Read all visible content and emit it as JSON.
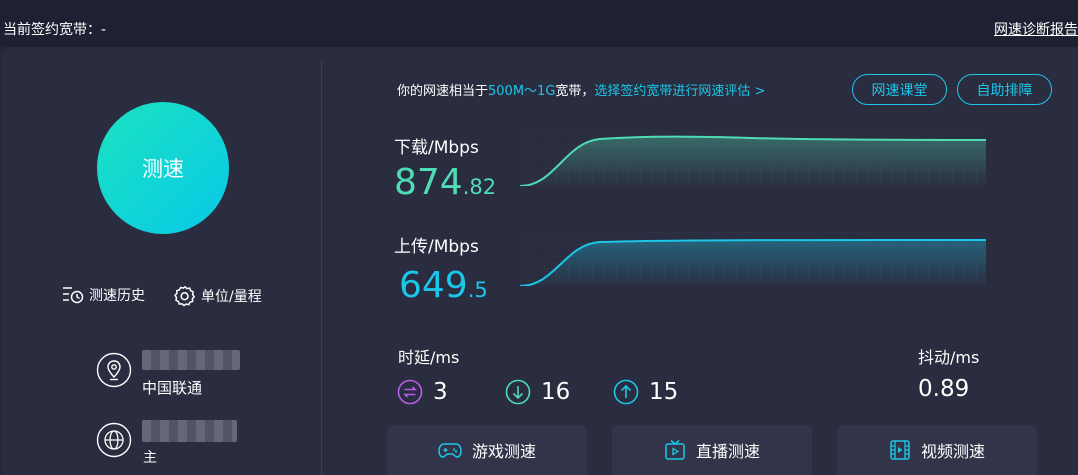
{
  "header": {
    "contract_label": "当前签约宽带：-",
    "diagnosis_link": "网速诊断报告"
  },
  "left": {
    "speed_button": "测速",
    "history_label": "测速历史",
    "unit_label": "单位/量程",
    "isp": "中国联通",
    "partial_text": "主"
  },
  "main": {
    "hint_prefix": "你的网速相当于",
    "hint_highlight": "500M～1G",
    "hint_mid": "宽带，",
    "hint_link": "选择签约宽带进行网速评估 >",
    "class_button": "网速课堂",
    "self_check_button": "自助排障",
    "download": {
      "label": "下载/Mbps",
      "int": "874",
      "dec": ".82",
      "color": "#4fdcb4"
    },
    "upload": {
      "label": "上传/Mbps",
      "int": "649",
      "dec": ".5",
      "color": "#1cc6e8"
    },
    "latency_label": "时延/ms",
    "latency": [
      {
        "icon": "swap-icon",
        "value": "3",
        "color": "#b95ee8"
      },
      {
        "icon": "download-arrow-icon",
        "value": "16",
        "color": "#4fdcb4"
      },
      {
        "icon": "upload-arrow-icon",
        "value": "15",
        "color": "#1cc6e8"
      }
    ],
    "jitter_label": "抖动/ms",
    "jitter_value": "0.89"
  },
  "bottom": {
    "game": "游戏测速",
    "live": "直播测速",
    "video": "视频测速"
  }
}
